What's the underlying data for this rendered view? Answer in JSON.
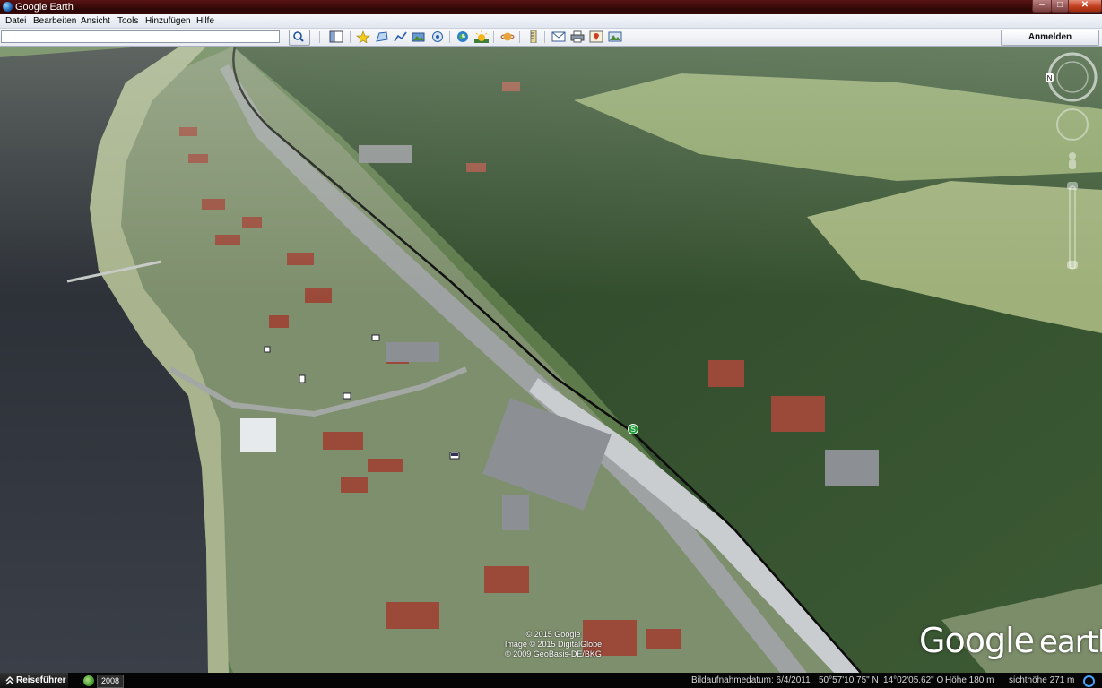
{
  "window": {
    "title": "Google Earth"
  },
  "menu": [
    "Datei",
    "Bearbeiten",
    "Ansicht",
    "Tools",
    "Hinzufügen",
    "Hilfe"
  ],
  "toolbar": {
    "search_value": "",
    "signin_label": "Anmelden",
    "buttons": [
      "search-icon",
      "sidebar-icon",
      "placemark-icon",
      "polygon-icon",
      "path-icon",
      "overlay-icon",
      "tour-icon",
      "history-icon",
      "sun-icon",
      "planets-icon",
      "ruler-icon",
      "email-icon",
      "print-icon",
      "maps-icon",
      "save-image-icon"
    ]
  },
  "viewport": {
    "marker_label": "S",
    "copyright": [
      "© 2015 Google",
      "Image © 2015 DigitalGlobe",
      "© 2009 GeoBasis-DE/BKG"
    ],
    "logo": {
      "brand": "Google",
      "product": "earth"
    }
  },
  "statusbar": {
    "tour_label": "Reiseführer",
    "year": "2008",
    "imagery_date": "Bildaufnahmedatum: 6/4/2011",
    "latitude": "50°57'10.75\" N",
    "longitude": "14°02'05.62\" O",
    "elevation": "Höhe  180 m",
    "eye_altitude": "sichthöhe   271 m"
  },
  "colors": {
    "titlebar": "#3a0a0a",
    "river": "#2b3038",
    "forest": "#2f4a2a",
    "meadow": "#9fb07a"
  }
}
